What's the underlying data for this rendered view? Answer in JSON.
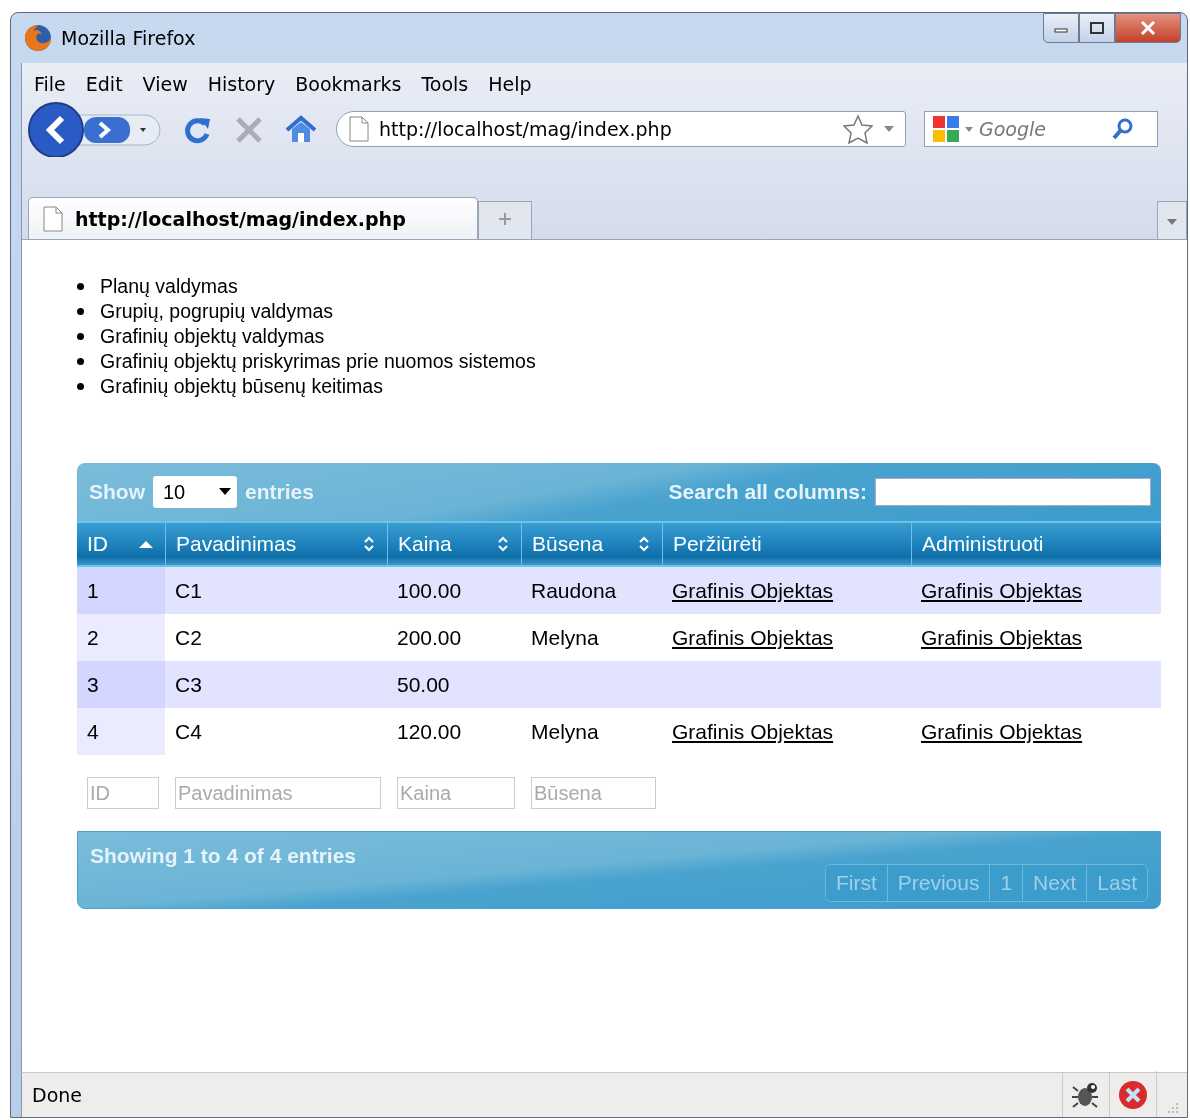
{
  "window": {
    "title": "Mozilla Firefox"
  },
  "menu": [
    "File",
    "Edit",
    "View",
    "History",
    "Bookmarks",
    "Tools",
    "Help"
  ],
  "address_bar": {
    "value": "http://localhost/mag/index.php"
  },
  "search_box": {
    "placeholder": "Google"
  },
  "tabs": [
    {
      "label": "http://localhost/mag/index.php",
      "selected": true
    }
  ],
  "nav_list": [
    "Planų valdymas",
    "Grupių, pogrupių valdymas",
    "Grafinių objektų valdymas",
    "Grafinių objektų priskyrimas prie nuomos sistemos",
    "Grafinių objektų būsenų keitimas"
  ],
  "table": {
    "length_label_before": "Show",
    "length_value": "10",
    "length_label_after": "entries",
    "search_label": "Search all columns:",
    "columns": [
      {
        "label": "ID",
        "kind": "ascending"
      },
      {
        "label": "Pavadinimas",
        "kind": "sortable"
      },
      {
        "label": "Kaina",
        "kind": "sortable"
      },
      {
        "label": "Būsena",
        "kind": "sortable"
      },
      {
        "label": "Peržiūrėti",
        "kind": "plain"
      },
      {
        "label": "Administruoti",
        "kind": "plain"
      }
    ],
    "rows": [
      {
        "cells": [
          {
            "text": "1"
          },
          {
            "text": "C1"
          },
          {
            "text": "100.00"
          },
          {
            "text": "Raudona"
          },
          {
            "text": "Grafinis Objektas",
            "kind": "link"
          },
          {
            "text": "Grafinis Objektas",
            "kind": "link"
          }
        ]
      },
      {
        "cells": [
          {
            "text": "2"
          },
          {
            "text": "C2"
          },
          {
            "text": "200.00"
          },
          {
            "text": "Melyna"
          },
          {
            "text": "Grafinis Objektas",
            "kind": "link"
          },
          {
            "text": "Grafinis Objektas",
            "kind": "link"
          }
        ]
      },
      {
        "cells": [
          {
            "text": "3"
          },
          {
            "text": "C3"
          },
          {
            "text": "50.00"
          },
          {},
          {},
          {}
        ]
      },
      {
        "cells": [
          {
            "text": "4"
          },
          {
            "text": "C4"
          },
          {
            "text": "120.00"
          },
          {
            "text": "Melyna"
          },
          {
            "text": "Grafinis Objektas",
            "kind": "link"
          },
          {
            "text": "Grafinis Objektas",
            "kind": "link"
          }
        ]
      }
    ],
    "filters": [
      {
        "placeholder": "ID"
      },
      {
        "placeholder": "Pavadinimas"
      },
      {
        "placeholder": "Kaina"
      },
      {
        "placeholder": "Būsena"
      }
    ],
    "info": "Showing 1 to 4 of 4 entries",
    "pager": [
      "First",
      "Previous",
      "1",
      "Next",
      "Last"
    ]
  },
  "status_bar": {
    "text": "Done"
  }
}
